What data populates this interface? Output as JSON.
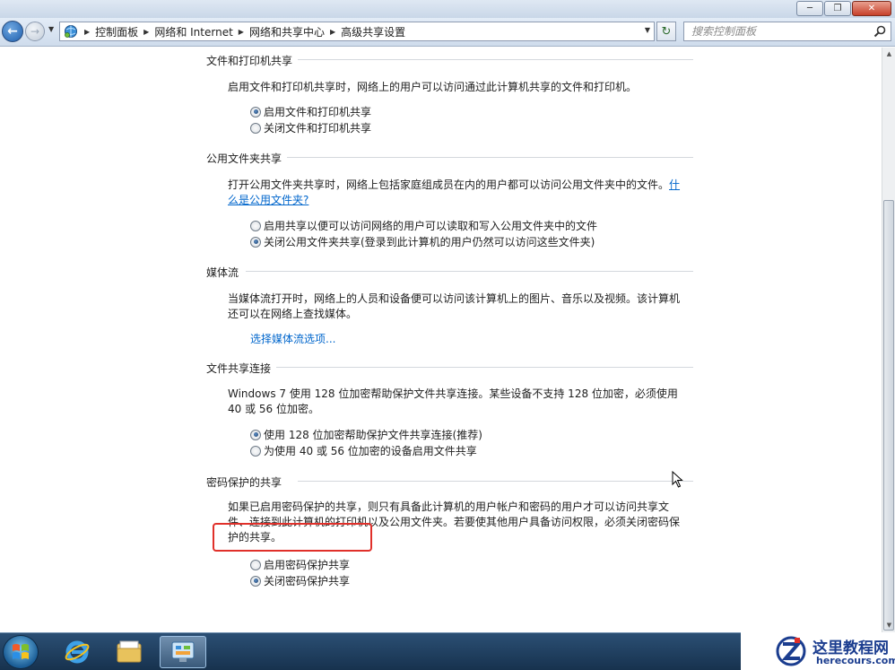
{
  "window": {
    "minimize_icon": "minimize-icon",
    "maximize_icon": "restore-icon",
    "close_icon": "close-icon"
  },
  "nav": {
    "breadcrumb": [
      "控制面板",
      "网络和 Internet",
      "网络和共享中心",
      "高级共享设置"
    ],
    "search_placeholder": "搜索控制面板"
  },
  "sections": [
    {
      "title": "文件和打印机共享",
      "description": "启用文件和打印机共享时，网络上的用户可以访问通过此计算机共享的文件和打印机。",
      "options": [
        {
          "label": "启用文件和打印机共享",
          "checked": true
        },
        {
          "label": "关闭文件和打印机共享",
          "checked": false
        }
      ]
    },
    {
      "title": "公用文件夹共享",
      "description": "打开公用文件夹共享时，网络上包括家庭组成员在内的用户都可以访问公用文件夹中的文件。",
      "link": "什么是公用文件夹?",
      "options": [
        {
          "label": "启用共享以便可以访问网络的用户可以读取和写入公用文件夹中的文件",
          "checked": false
        },
        {
          "label": "关闭公用文件夹共享(登录到此计算机的用户仍然可以访问这些文件夹)",
          "checked": true
        }
      ]
    },
    {
      "title": "媒体流",
      "description": "当媒体流打开时，网络上的人员和设备便可以访问该计算机上的图片、音乐以及视频。该计算机还可以在网络上查找媒体。",
      "link": "选择媒体流选项..."
    },
    {
      "title": "文件共享连接",
      "description": "Windows 7 使用 128 位加密帮助保护文件共享连接。某些设备不支持 128 位加密，必须使用 40 或 56 位加密。",
      "options": [
        {
          "label": "使用 128 位加密帮助保护文件共享连接(推荐)",
          "checked": true
        },
        {
          "label": "为使用 40 或 56 位加密的设备启用文件共享",
          "checked": false
        }
      ]
    },
    {
      "title": "密码保护的共享",
      "description": "如果已启用密码保护的共享，则只有具备此计算机的用户帐户和密码的用户才可以访问共享文件、连接到此计算机的打印机以及公用文件夹。若要使其他用户具备访问权限，必须关闭密码保护的共享。",
      "options": [
        {
          "label": "启用密码保护共享",
          "checked": false
        },
        {
          "label": "关闭密码保护共享",
          "checked": true
        }
      ]
    }
  ],
  "taskbar": {
    "items": [
      "start-orb-icon",
      "internet-explorer-icon",
      "file-explorer-icon",
      "control-panel-icon"
    ]
  },
  "watermark": {
    "name": "这里教程网",
    "url": "herecours.com"
  }
}
